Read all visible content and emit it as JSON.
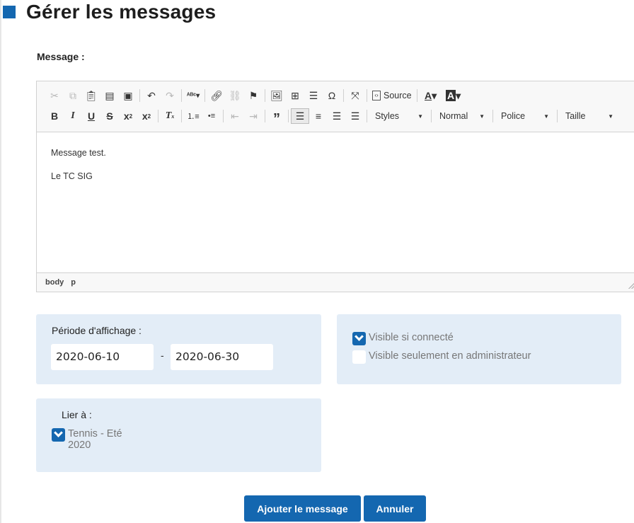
{
  "page": {
    "title": "Gérer les messages",
    "accent": "#1467b0"
  },
  "message_label": "Message :",
  "editor": {
    "toolbar": {
      "row1": [
        "cut-icon",
        "copy-icon",
        "paste-icon",
        "paste-text-icon",
        "paste-word-icon",
        "undo-icon",
        "redo-icon",
        "spellcheck-icon",
        "link-icon",
        "unlink-icon",
        "anchor-icon",
        "image-icon",
        "table-icon",
        "horizontal-rule-icon",
        "special-char-icon",
        "maximize-icon"
      ],
      "source_label": "Source",
      "row2": [
        "bold-icon",
        "italic-icon",
        "underline-icon",
        "strike-icon",
        "subscript-icon",
        "superscript-icon",
        "remove-format-icon",
        "numbered-list-icon",
        "bulleted-list-icon",
        "outdent-icon",
        "indent-icon",
        "blockquote-icon",
        "align-left-icon",
        "align-center-icon",
        "align-right-icon",
        "justify-icon"
      ],
      "styles_label": "Styles",
      "format_label": "Normal",
      "font_label": "Police",
      "size_label": "Taille"
    },
    "content": [
      "Message test.",
      "Le TC SIG"
    ],
    "path": [
      "body",
      "p"
    ]
  },
  "period": {
    "label": "Période d'affichage :",
    "start": "2020-06-10",
    "separator": "-",
    "end": "2020-06-30"
  },
  "visibility": {
    "connected": {
      "label": "Visible si connecté",
      "checked": true
    },
    "admin_only": {
      "label": "Visible seulement en administrateur",
      "checked": false
    }
  },
  "link": {
    "label": "Lier à :",
    "item_line1": "Tennis - Eté",
    "item_line2": "2020",
    "checked": true
  },
  "buttons": {
    "add": "Ajouter le message",
    "cancel": "Annuler"
  }
}
